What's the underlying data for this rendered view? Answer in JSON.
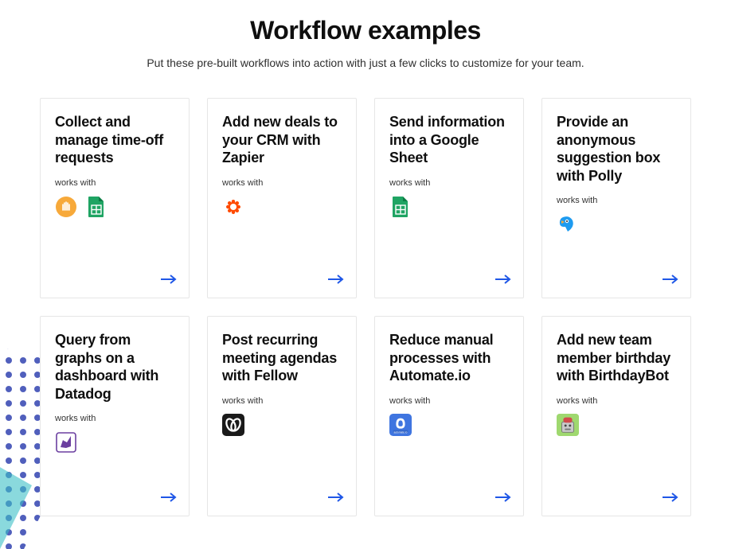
{
  "header": {
    "title": "Workflow examples",
    "subtitle": "Put these pre-built workflows into action with just a few clicks to customize for your team."
  },
  "works_with_label": "works with",
  "cards": [
    {
      "title": "Collect and manage time-off requests",
      "integrations": [
        "slack-hand",
        "google-sheets"
      ]
    },
    {
      "title": "Add new deals to your CRM with Zapier",
      "integrations": [
        "zapier"
      ]
    },
    {
      "title": "Send information into a Google Sheet",
      "integrations": [
        "google-sheets"
      ]
    },
    {
      "title": "Provide an anonymous suggestion box with Polly",
      "integrations": [
        "polly"
      ]
    },
    {
      "title": "Query from graphs on a dashboard with Datadog",
      "integrations": [
        "datadog"
      ]
    },
    {
      "title": "Post recurring meeting agendas with Fellow",
      "integrations": [
        "fellow"
      ]
    },
    {
      "title": "Reduce manual processes with Automate.io",
      "integrations": [
        "automateio"
      ]
    },
    {
      "title": "Add new team member birthday with BirthdayBot",
      "integrations": [
        "birthdaybot"
      ]
    }
  ]
}
